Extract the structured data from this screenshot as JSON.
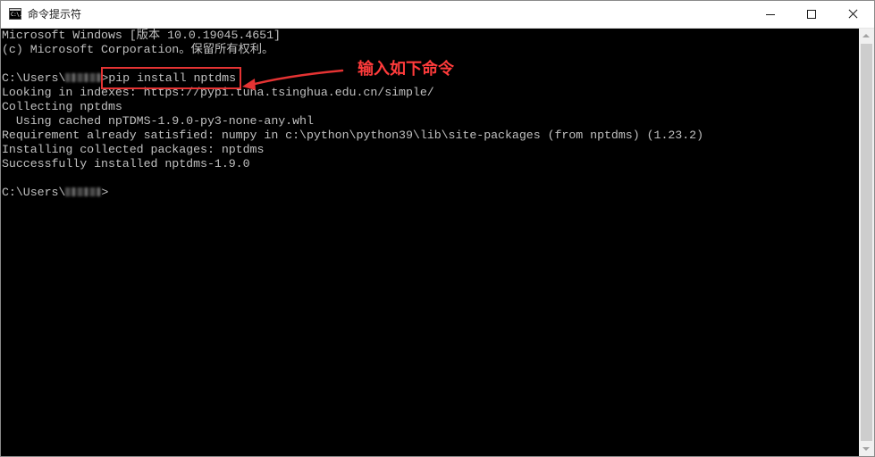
{
  "window": {
    "title": "命令提示符",
    "icon": "cmd-icon",
    "icon_text": "C:\\.",
    "minimize_icon": "minimize-icon",
    "maximize_icon": "maximize-icon",
    "close_icon": "close-icon"
  },
  "console": {
    "lines": [
      "Microsoft Windows [版本 10.0.19045.4651]",
      "(c) Microsoft Corporation。保留所有权利。",
      "",
      "C:\\Users\\",
      "Looking in indexes: https://pypi.tuna.tsinghua.edu.cn/simple/",
      "Collecting nptdms",
      "  Using cached npTDMS-1.9.0-py3-none-any.whl",
      "Requirement already satisfied: numpy in c:\\python\\python39\\lib\\site-packages (from nptdms) (1.23.2)",
      "Installing collected packages: nptdms",
      "Successfully installed nptdms-1.9.0",
      "",
      "C:\\Users\\"
    ],
    "prompt1_suffix": ">pip install nptdms",
    "prompt2_suffix": ">"
  },
  "annotation": {
    "text": "输入如下命令",
    "color": "#ff3b3b"
  },
  "colors": {
    "console_bg": "#000000",
    "console_text": "#c0c0c0",
    "titlebar_bg": "#ffffff"
  }
}
